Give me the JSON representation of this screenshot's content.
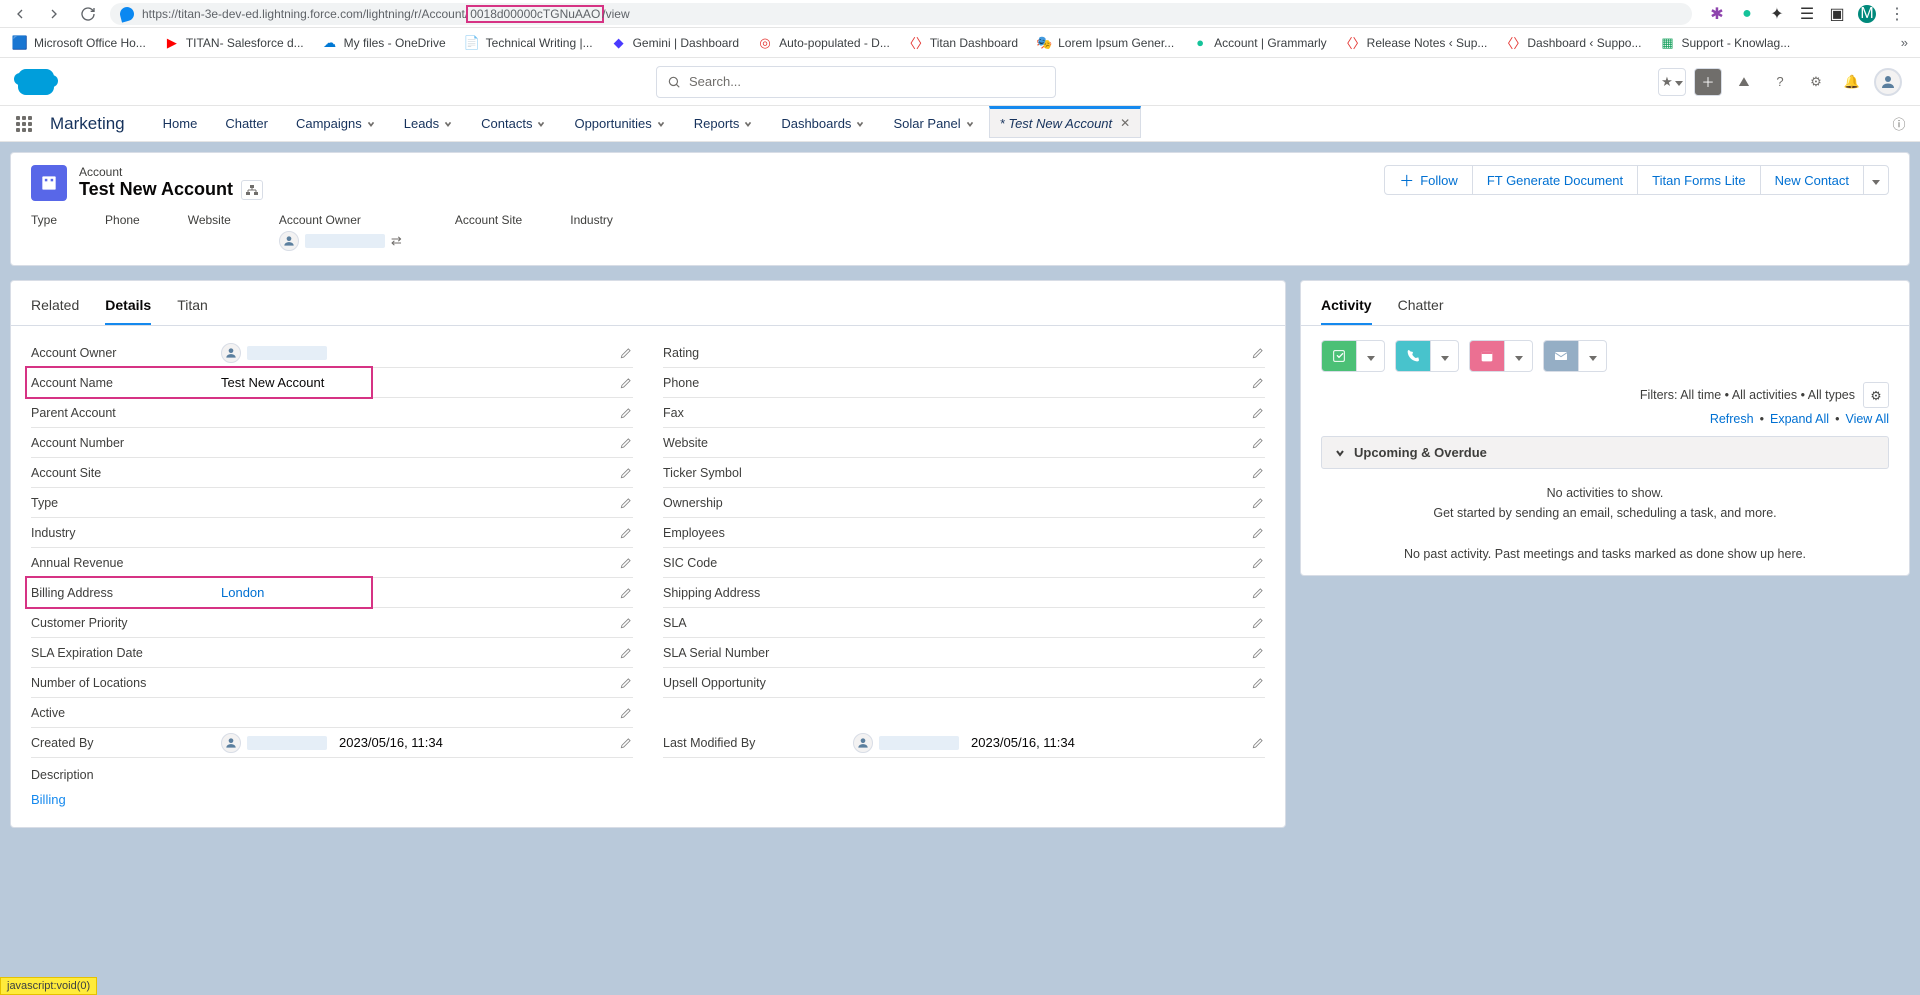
{
  "url_pre": "https://titan-3e-dev-ed.lightning.force.com/lightning/r/Account/",
  "url_hl": "0018d00000cTGNuAAO",
  "url_post": "/view",
  "chrome_avatar": "M",
  "bookmarks": [
    "Microsoft Office Ho...",
    "TITAN- Salesforce d...",
    "My files - OneDrive",
    "Technical Writing |...",
    "Gemini | Dashboard",
    "Auto-populated - D...",
    "Titan Dashboard",
    "Lorem Ipsum Gener...",
    "Account | Grammarly",
    "Release Notes ‹ Sup...",
    "Dashboard ‹ Suppo...",
    "Support - Knowlag..."
  ],
  "search_placeholder": "Search...",
  "app_name": "Marketing",
  "nav": [
    "Home",
    "Chatter",
    "Campaigns",
    "Leads",
    "Contacts",
    "Opportunities",
    "Reports",
    "Dashboards",
    "Solar Panel"
  ],
  "active_tab": "* Test New Account",
  "object_label": "Account",
  "record_title": "Test New Account",
  "header_actions": {
    "follow": "Follow",
    "gen": "FT Generate Document",
    "lite": "Titan Forms Lite",
    "newc": "New Contact"
  },
  "header_fields": [
    "Type",
    "Phone",
    "Website",
    "Account Owner",
    "Account Site",
    "Industry"
  ],
  "tabs_left": {
    "related": "Related",
    "details": "Details",
    "titan": "Titan"
  },
  "fields_left": [
    {
      "label": "Account Owner",
      "value": "",
      "owner": true
    },
    {
      "label": "Account Name",
      "value": "Test New Account",
      "hl": true
    },
    {
      "label": "Parent Account",
      "value": ""
    },
    {
      "label": "Account Number",
      "value": ""
    },
    {
      "label": "Account Site",
      "value": ""
    },
    {
      "label": "Type",
      "value": ""
    },
    {
      "label": "Industry",
      "value": ""
    },
    {
      "label": "Annual Revenue",
      "value": ""
    },
    {
      "label": "Billing Address",
      "value": "London",
      "hl": true,
      "link": true
    },
    {
      "label": "Customer Priority",
      "value": ""
    },
    {
      "label": "SLA Expiration Date",
      "value": ""
    },
    {
      "label": "Number of Locations",
      "value": ""
    },
    {
      "label": "Active",
      "value": ""
    },
    {
      "label": "Created By",
      "value": "2023/05/16, 11:34",
      "owner": true
    }
  ],
  "fields_right": [
    {
      "label": "Rating",
      "value": ""
    },
    {
      "label": "Phone",
      "value": ""
    },
    {
      "label": "Fax",
      "value": ""
    },
    {
      "label": "Website",
      "value": ""
    },
    {
      "label": "Ticker Symbol",
      "value": ""
    },
    {
      "label": "Ownership",
      "value": ""
    },
    {
      "label": "Employees",
      "value": ""
    },
    {
      "label": "SIC Code",
      "value": ""
    },
    {
      "label": "Shipping Address",
      "value": ""
    },
    {
      "label": "SLA",
      "value": ""
    },
    {
      "label": "SLA Serial Number",
      "value": ""
    },
    {
      "label": "Upsell Opportunity",
      "value": ""
    },
    {
      "label": "",
      "value": ""
    },
    {
      "label": "Last Modified By",
      "value": "2023/05/16, 11:34",
      "owner": true
    }
  ],
  "description_label": "Description",
  "billing_link": "Billing",
  "tabs_right": {
    "activity": "Activity",
    "chatter": "Chatter"
  },
  "filters_text": "Filters: All time • All activities • All types",
  "refresh": "Refresh",
  "expand": "Expand All",
  "viewall": "View All",
  "upcoming": "Upcoming & Overdue",
  "empty1": "No activities to show.",
  "empty2": "Get started by sending an email, scheduling a task, and more.",
  "past": "No past activity. Past meetings and tasks marked as done show up here.",
  "status": "javascript:void(0)"
}
